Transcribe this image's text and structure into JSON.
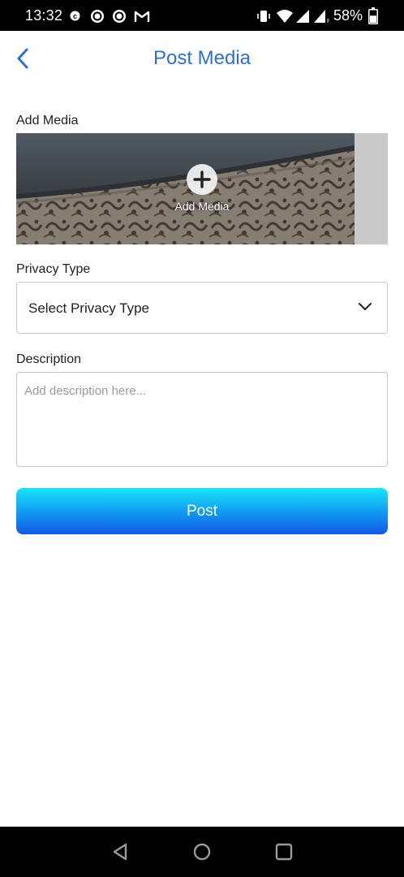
{
  "status_bar": {
    "time": "13:32",
    "battery_percent": "58%",
    "battery_level": 0.58,
    "left_icons": [
      "notification-c-icon",
      "circle-notification-icon",
      "circle-notification-icon",
      "gmail-icon"
    ],
    "right_icons": [
      "vibrate-icon",
      "wifi-icon",
      "signal-icon",
      "signal-r-icon",
      "battery-icon"
    ]
  },
  "header": {
    "title": "Post Media",
    "back_icon": "chevron-left-icon",
    "accent_color": "#2f6fd3"
  },
  "media": {
    "section_label": "Add Media",
    "button_label": "Add Media",
    "icon": "plus-circle-icon"
  },
  "privacy": {
    "section_label": "Privacy Type",
    "selected_value": "Select Privacy Type",
    "icon": "chevron-down-icon"
  },
  "description": {
    "section_label": "Description",
    "value": "",
    "placeholder": "Add description here..."
  },
  "actions": {
    "post_label": "Post",
    "gradient_colors": [
      "#18e6f7",
      "#1558e6"
    ]
  },
  "nav_bar": {
    "icons": [
      "back-triangle-icon",
      "home-circle-icon",
      "recents-square-icon"
    ]
  }
}
